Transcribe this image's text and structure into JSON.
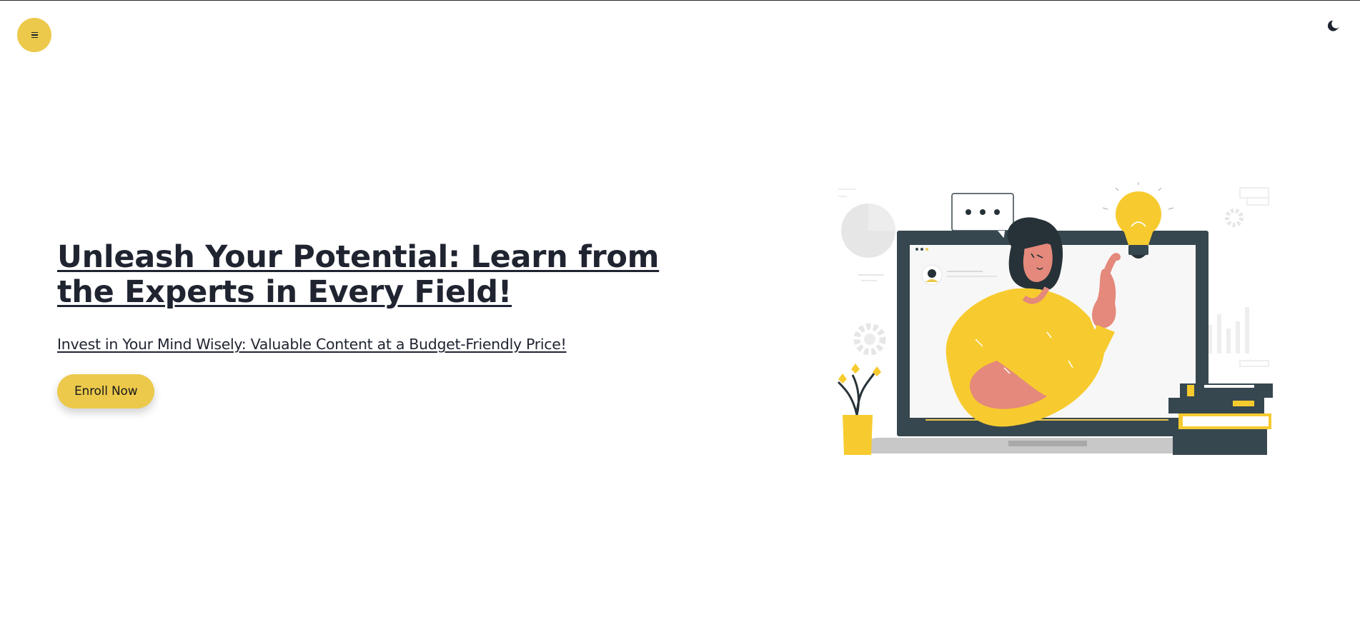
{
  "header": {
    "menu_icon": "hamburger-menu-icon",
    "theme_toggle_icon": "moon-icon"
  },
  "hero": {
    "title": "Unleash Your Potential: Learn from the Experts in Every Field!",
    "subtitle": "Invest in Your Mind Wisely: Valuable Content at a Budget-Friendly Price!",
    "cta_label": "Enroll Now",
    "illustration": "woman-on-laptop-with-lightbulb-illustration"
  },
  "colors": {
    "accent": "#ECC94B",
    "text": "#1F2430",
    "dark_screen": "#37474F",
    "light_gray": "#E0E0E0",
    "skin": "#E4897B"
  }
}
